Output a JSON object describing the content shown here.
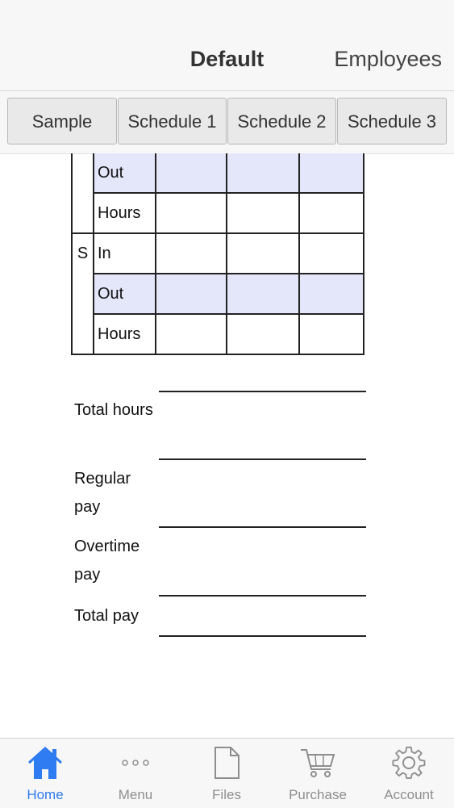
{
  "nav": {
    "title": "Default",
    "right": "Employees"
  },
  "tabs": [
    "Sample",
    "Schedule 1",
    "Schedule 2",
    "Schedule 3"
  ],
  "grid": {
    "rows": [
      {
        "day": "",
        "label": "Out"
      },
      {
        "day": "",
        "label": "Hours"
      },
      {
        "day": "S",
        "label": "In"
      },
      {
        "day": "",
        "label": "Out"
      },
      {
        "day": "",
        "label": "Hours"
      }
    ]
  },
  "summary": {
    "total_hours": "Total hours",
    "regular_pay": "Regular pay",
    "overtime_pay": "Overtime pay",
    "total_pay": "Total pay"
  },
  "tabbar": {
    "items": [
      {
        "label": "Home",
        "icon": "home-icon",
        "active": true
      },
      {
        "label": "Menu",
        "icon": "more-icon",
        "active": false
      },
      {
        "label": "Files",
        "icon": "file-icon",
        "active": false
      },
      {
        "label": "Purchase",
        "icon": "cart-icon",
        "active": false
      },
      {
        "label": "Account",
        "icon": "gear-icon",
        "active": false
      }
    ]
  },
  "colors": {
    "accent": "#2f7bf1",
    "shade": "#e4e6fa",
    "inactive": "#8e8e8e"
  }
}
